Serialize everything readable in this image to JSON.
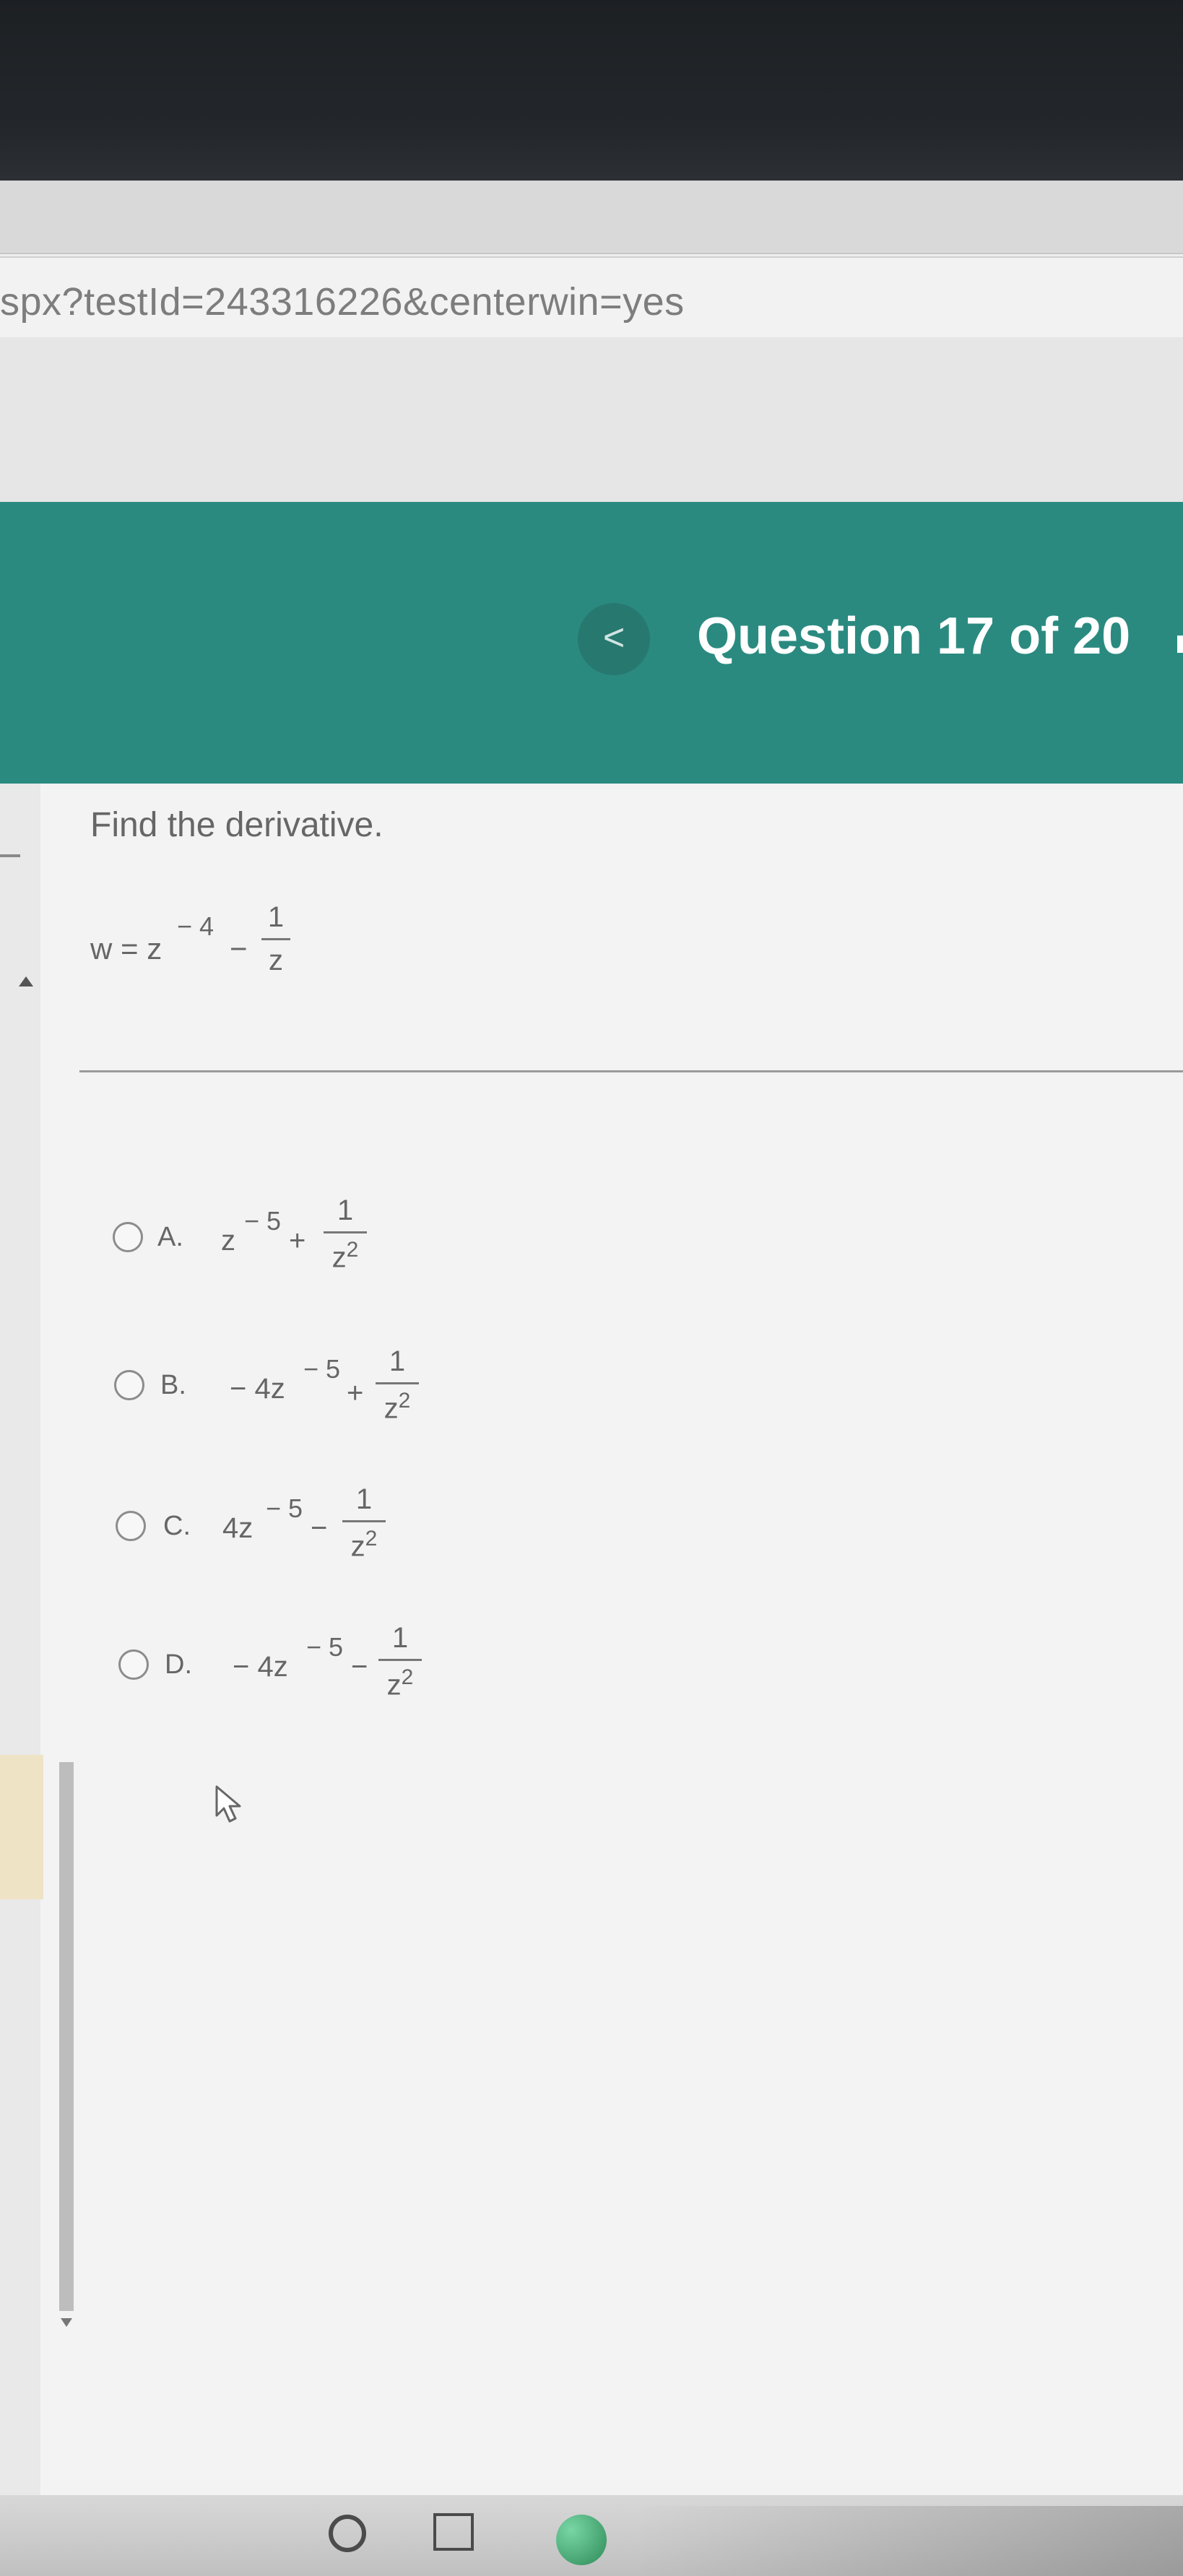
{
  "browser": {
    "url_fragment": "spx?testId=243316226&centerwin=yes"
  },
  "header": {
    "prev_label": "<",
    "question_counter": "Question 17 of 20"
  },
  "question": {
    "prompt": "Find the derivative.",
    "equation": {
      "lhs": "w = z",
      "lhs_exp": "− 4",
      "op": "−",
      "frac_num": "1",
      "frac_den": "z"
    }
  },
  "options": [
    {
      "letter": "A.",
      "term_coef": "z",
      "term_exp": "− 5",
      "op": "+",
      "frac_num": "1",
      "frac_den": "z",
      "frac_den_exp": "2"
    },
    {
      "letter": "B.",
      "term_coef": "− 4z",
      "term_exp": "− 5",
      "op": "+",
      "frac_num": "1",
      "frac_den": "z",
      "frac_den_exp": "2"
    },
    {
      "letter": "C.",
      "term_coef": "4z",
      "term_exp": "− 5",
      "op": "−",
      "frac_num": "1",
      "frac_den": "z",
      "frac_den_exp": "2"
    },
    {
      "letter": "D.",
      "term_coef": "− 4z",
      "term_exp": "− 5",
      "op": "−",
      "frac_num": "1",
      "frac_den": "z",
      "frac_den_exp": "2"
    }
  ],
  "colors": {
    "header_teal": "#2a8a80",
    "text_gray": "#666666"
  }
}
